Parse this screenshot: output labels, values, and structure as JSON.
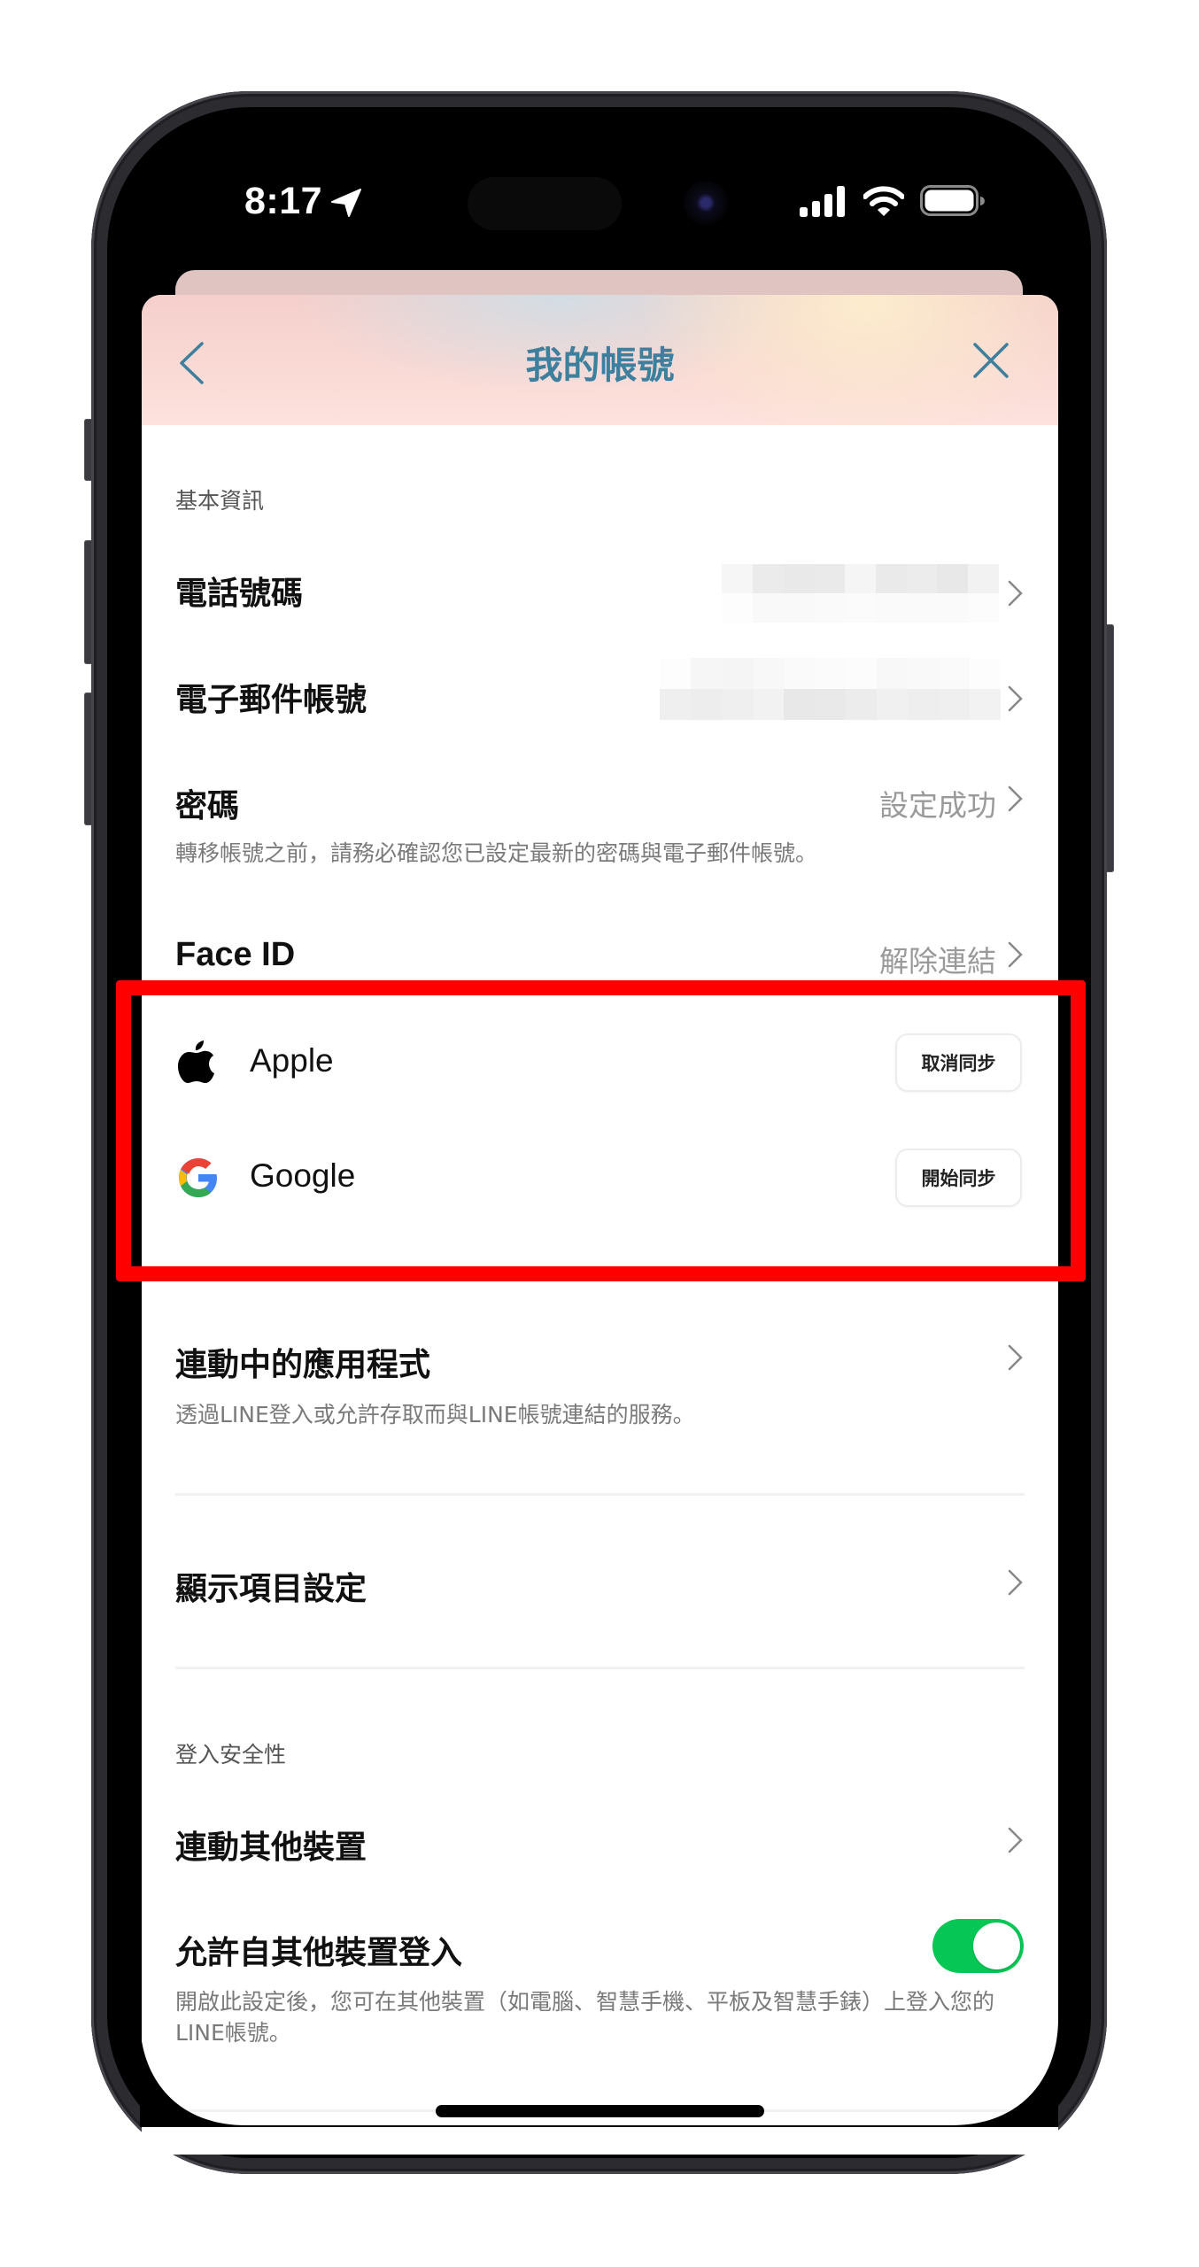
{
  "status_bar": {
    "time": "8:17",
    "location_icon": "location-arrow-icon",
    "signal_icon": "cellular-signal-icon",
    "wifi_icon": "wifi-icon",
    "battery_icon": "battery-icon"
  },
  "header": {
    "title": "我的帳號",
    "back_icon": "chevron-left-icon",
    "close_icon": "close-icon",
    "title_color": "#3e7f9e"
  },
  "basic_info": {
    "section_label": "基本資訊",
    "phone": {
      "label": "電話號碼",
      "value_redacted": true
    },
    "email": {
      "label": "電子郵件帳號",
      "value_redacted": true
    },
    "password": {
      "label": "密碼",
      "value": "設定成功",
      "note": "轉移帳號之前，請務必確認您已設定最新的密碼與電子郵件帳號。"
    },
    "face_id": {
      "label": "Face ID",
      "value": "解除連結"
    }
  },
  "linked_services": [
    {
      "name": "Apple",
      "icon": "apple-logo-icon",
      "button_label": "取消同步"
    },
    {
      "name": "Google",
      "icon": "google-logo-icon",
      "button_label": "開始同步"
    }
  ],
  "linked_apps": {
    "label": "連動中的應用程式",
    "note": "透過LINE登入或允許存取而與LINE帳號連結的服務。"
  },
  "display_settings": {
    "label": "顯示項目設定"
  },
  "login_security": {
    "section_label": "登入安全性",
    "link_devices": {
      "label": "連動其他裝置"
    },
    "allow_other_devices": {
      "label": "允許自其他裝置登入",
      "enabled": true,
      "note": "開啟此設定後，您可在其他裝置（如電腦、智慧手機、平板及智慧手錶）上登入您的LINE帳號。"
    }
  },
  "colors": {
    "accent_green": "#06c755",
    "highlight_red": "#ff0000",
    "header_title": "#3e7f9e"
  }
}
